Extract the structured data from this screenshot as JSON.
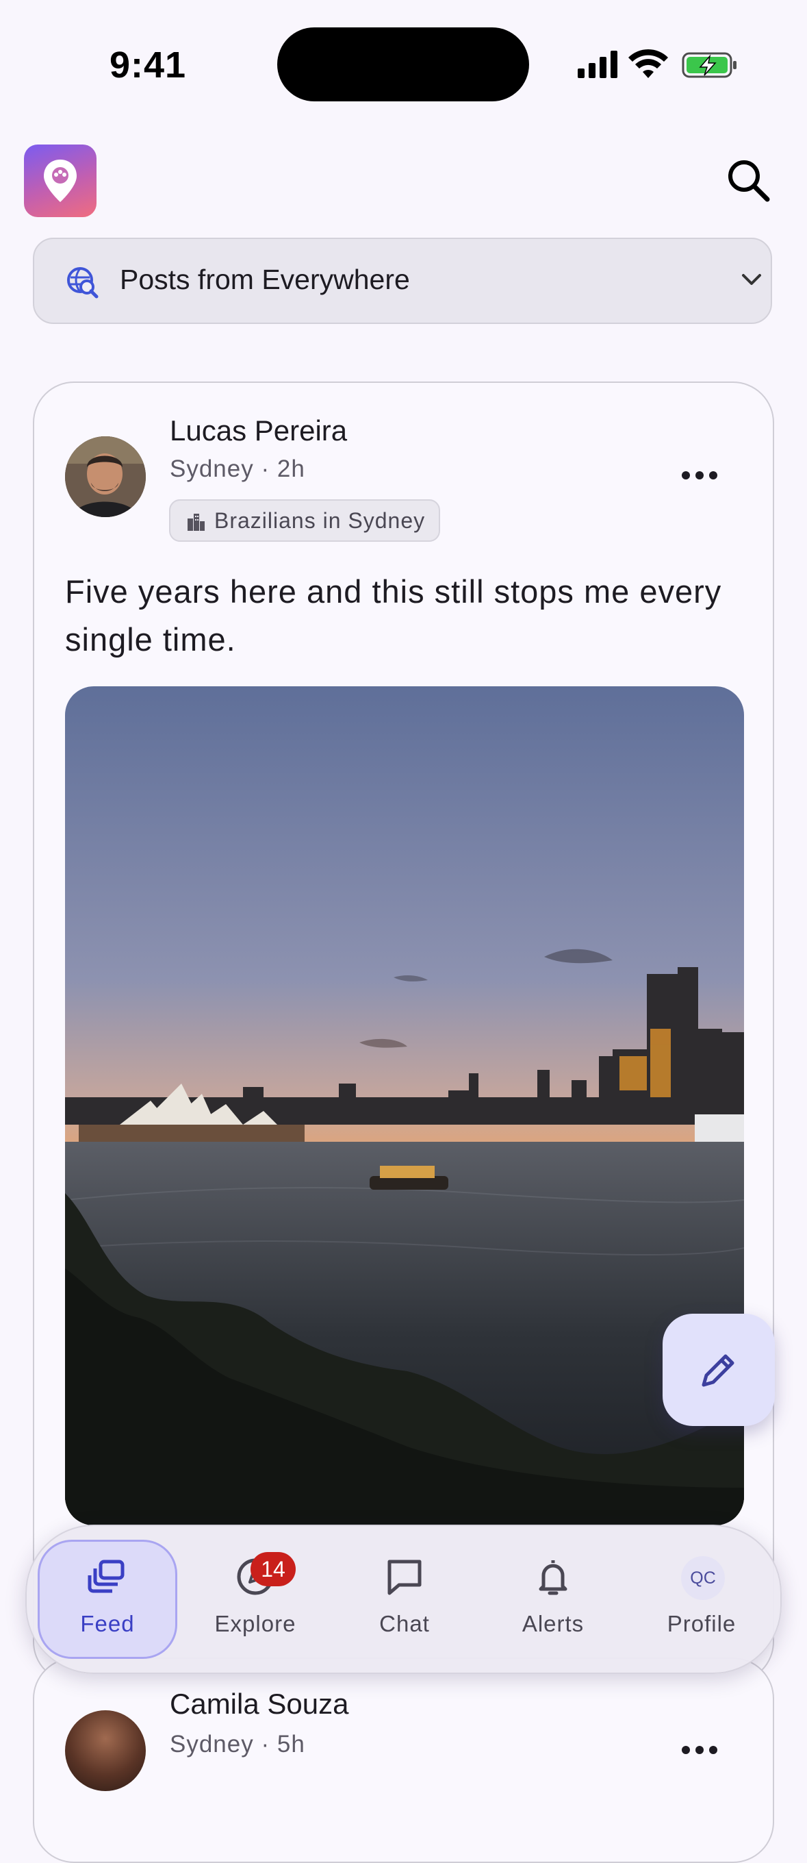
{
  "status_bar": {
    "time": "9:41"
  },
  "header": {
    "logo": "location-pin-logo",
    "search_icon": "search-icon"
  },
  "filter": {
    "label": "Posts from Everywhere",
    "icon": "globe-search-icon",
    "chevron": "chevron-down-icon"
  },
  "posts": [
    {
      "author": "Lucas Pereira",
      "location": "Sydney",
      "separator": "·",
      "time": "2h",
      "group": "Brazilians in Sydney",
      "text": "Five years here and this still stops me every single time.",
      "photo": "sydney-harbour-sunset-photo"
    },
    {
      "author": "Camila Souza",
      "location": "Sydney",
      "separator": "·",
      "time": "5h"
    }
  ],
  "fab": {
    "icon": "pencil-icon"
  },
  "tabbar": {
    "tabs": [
      {
        "label": "Feed",
        "icon": "feed-icon",
        "active": true
      },
      {
        "label": "Explore",
        "icon": "compass-icon",
        "badge": "14"
      },
      {
        "label": "Chat",
        "icon": "chat-bubble-icon"
      },
      {
        "label": "Alerts",
        "icon": "bell-icon"
      },
      {
        "label": "Profile",
        "initials": "QC"
      }
    ]
  },
  "colors": {
    "accent": "#3a3fc4",
    "badge": "#c9201b",
    "fab_bg": "#e1e1fb",
    "background": "#f9f6fd"
  }
}
